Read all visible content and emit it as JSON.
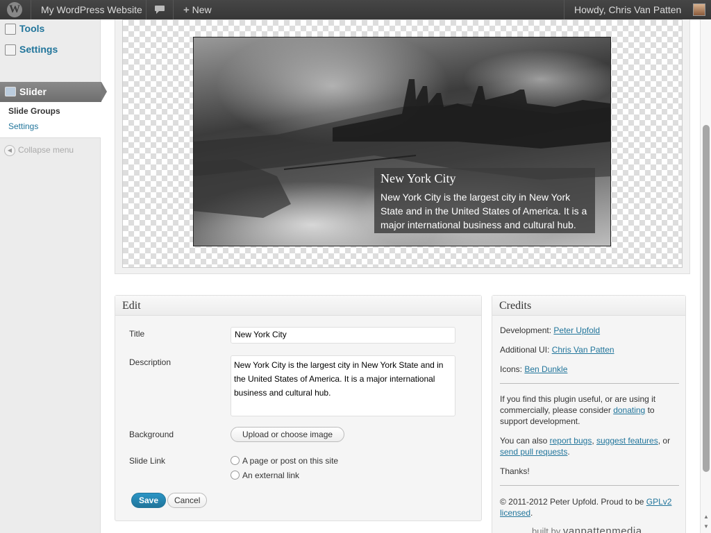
{
  "adminbar": {
    "logo": "W",
    "site_name": "My WordPress Website",
    "comments_icon": "comment-bubble-icon",
    "new_label": "New",
    "howdy": "Howdy, Chris Van Patten"
  },
  "menu": {
    "tools_label": "Tools",
    "settings_label": "Settings",
    "slider_label": "Slider",
    "sub_slide_groups": "Slide Groups",
    "sub_settings": "Settings",
    "collapse_label": "Collapse menu"
  },
  "slide": {
    "title": "New York City",
    "description": "New York City is the largest city in New York State and in the United States of America. It is a major international business and cultural hub."
  },
  "edit": {
    "heading": "Edit",
    "title_label": "Title",
    "title_value": "New York City",
    "description_label": "Description",
    "description_value": "New York City is the largest city in New York State and in the United States of America. It is a major international business and cultural hub.",
    "background_label": "Background",
    "upload_button": "Upload or choose image",
    "slide_link_label": "Slide Link",
    "option_page": "A page or post on this site",
    "option_external": "An external link",
    "save": "Save",
    "cancel": "Cancel"
  },
  "credits": {
    "heading": "Credits",
    "development_label": "Development:",
    "development_link": "Peter Upfold",
    "additional_ui_label": "Additional UI:",
    "additional_ui_link": "Chris Van Patten",
    "icons_label": "Icons:",
    "icons_link": "Ben Dunkle",
    "useful_text_1": "If you find this plugin useful, or are using it commercially, please consider",
    "donating_link": "donating",
    "useful_text_2": "to support development.",
    "also_text": "You can also",
    "report_bugs_link": "report bugs",
    "suggest_features_link": "suggest features",
    "or_text": ", or",
    "pull_requests_link": "send pull requests",
    "thanks": "Thanks!",
    "copyright": "© 2011-2012 Peter Upfold. Proud to be",
    "gpl_link": "GPLv2 licensed",
    "built_by": "built by",
    "built_by_brand": "vanpattenmedia"
  },
  "colors": {
    "link": "#21759b",
    "primary_button": "#21759b",
    "adminbar": "#464646",
    "menu_current": "#7a7a7a"
  }
}
